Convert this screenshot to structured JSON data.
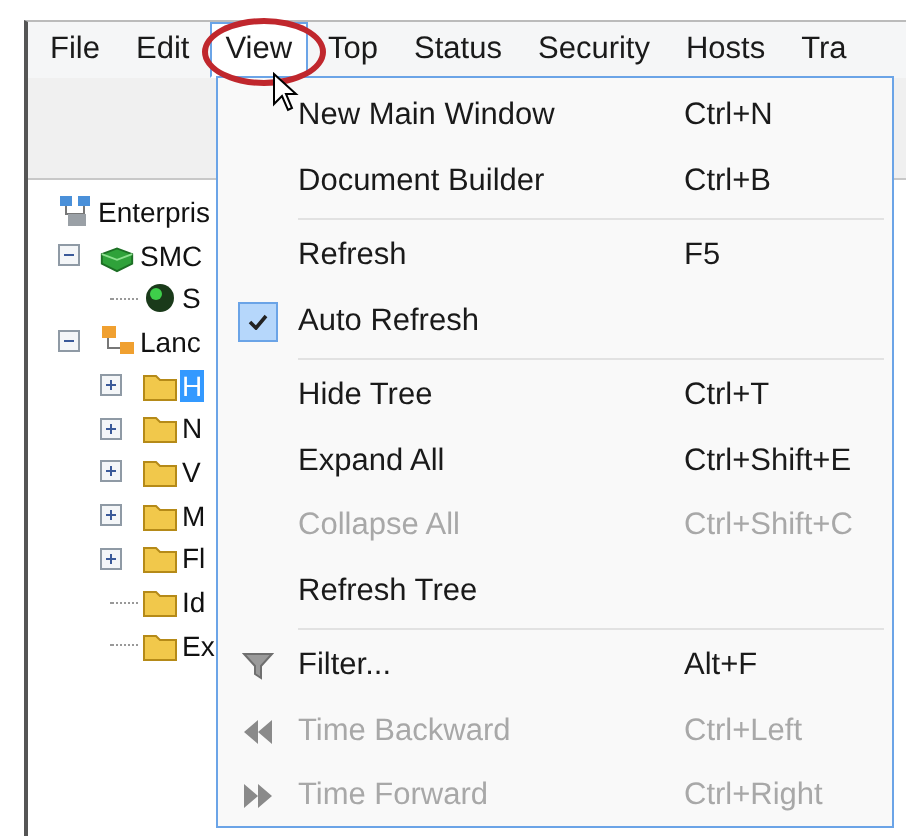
{
  "menu_bar": [
    {
      "label": "File",
      "selected": false
    },
    {
      "label": "Edit",
      "selected": false
    },
    {
      "label": "View",
      "selected": true
    },
    {
      "label": "Top",
      "selected": false
    },
    {
      "label": "Status",
      "selected": false
    },
    {
      "label": "Security",
      "selected": false
    },
    {
      "label": "Hosts",
      "selected": false
    },
    {
      "label": "Tra",
      "selected": false
    }
  ],
  "tree": [
    {
      "label": "Enterpris",
      "kind": "enterprise",
      "selected": false,
      "children": [
        {
          "label": "SMC",
          "kind": "server",
          "selected": false,
          "expanded": true,
          "children": [
            {
              "label": "S",
              "kind": "status",
              "selected": false
            }
          ]
        },
        {
          "label": "Lanc",
          "kind": "network",
          "selected": false,
          "expanded": true,
          "children": [
            {
              "label": "H",
              "kind": "folder",
              "selected": true,
              "expanded": false
            },
            {
              "label": "N",
              "kind": "folder",
              "selected": false,
              "expanded": false
            },
            {
              "label": "V",
              "kind": "folder",
              "selected": false,
              "expanded": false
            },
            {
              "label": "M",
              "kind": "folder",
              "selected": false,
              "expanded": false
            },
            {
              "label": "Fl",
              "kind": "folder",
              "selected": false,
              "expanded": false
            },
            {
              "label": "Id",
              "kind": "folder",
              "selected": false
            },
            {
              "label": "Ex",
              "kind": "folder",
              "selected": false
            }
          ]
        }
      ]
    }
  ],
  "view_menu": [
    {
      "kind": "item",
      "label": "New Main Window",
      "shortcut": "Ctrl+N",
      "disabled": false,
      "checked": false
    },
    {
      "kind": "item",
      "label": "Document Builder",
      "shortcut": "Ctrl+B",
      "disabled": false,
      "checked": false
    },
    {
      "kind": "separator"
    },
    {
      "kind": "item",
      "label": "Refresh",
      "shortcut": "F5",
      "disabled": false,
      "checked": false
    },
    {
      "kind": "item",
      "label": "Auto Refresh",
      "disabled": false,
      "checked": true
    },
    {
      "kind": "separator"
    },
    {
      "kind": "item",
      "label": "Hide Tree",
      "shortcut": "Ctrl+T",
      "disabled": false,
      "checked": false
    },
    {
      "kind": "item",
      "label": "Expand All",
      "shortcut": "Ctrl+Shift+E",
      "disabled": false,
      "checked": false
    },
    {
      "kind": "item",
      "label": "Collapse All",
      "shortcut": "Ctrl+Shift+C",
      "disabled": true,
      "checked": false
    },
    {
      "kind": "item",
      "label": "Refresh Tree",
      "disabled": false,
      "checked": false
    },
    {
      "kind": "separator"
    },
    {
      "kind": "item",
      "label": "Filter...",
      "shortcut": "Alt+F",
      "disabled": false,
      "checked": false
    },
    {
      "kind": "item",
      "label": "Time Backward",
      "shortcut": "Ctrl+Left",
      "disabled": true,
      "checked": false
    },
    {
      "kind": "item",
      "label": "Time Forward",
      "shortcut": "Ctrl+Right",
      "disabled": true,
      "checked": false
    }
  ]
}
